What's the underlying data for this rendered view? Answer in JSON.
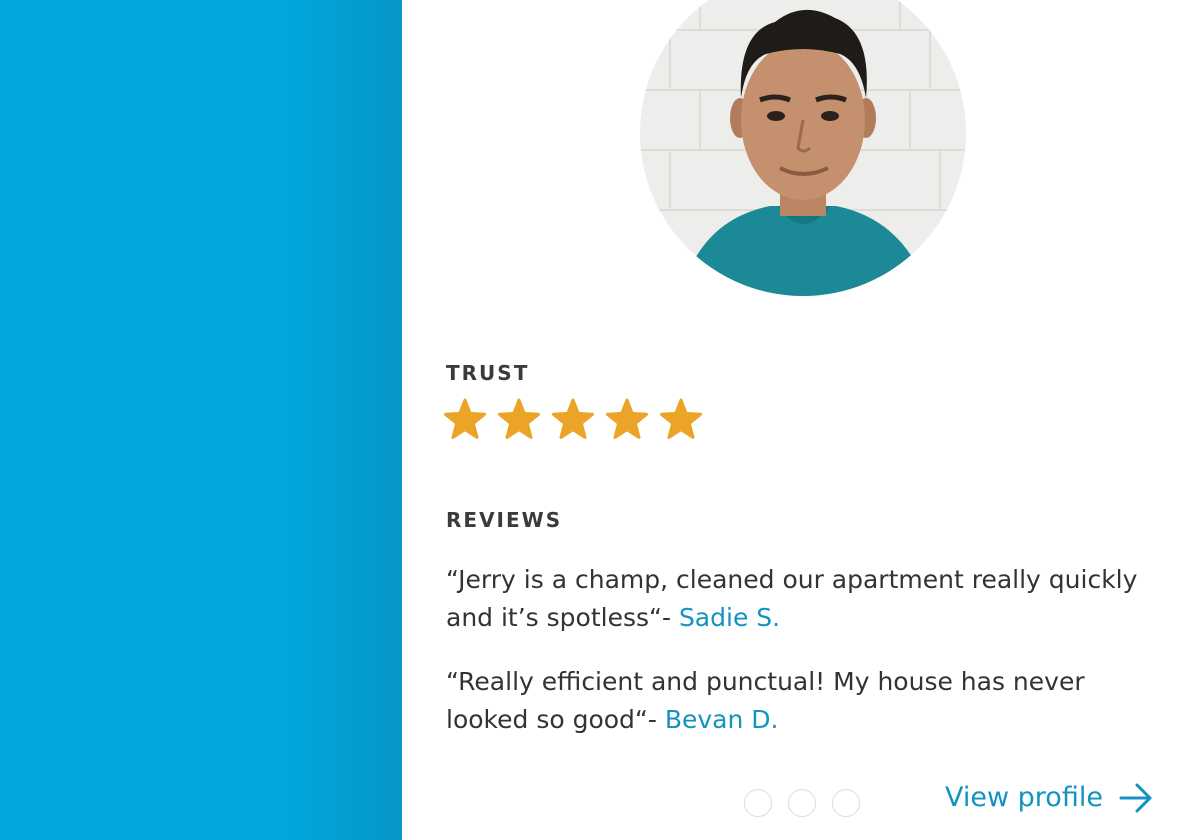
{
  "colors": {
    "accent_blue": "#00a8df",
    "link_blue": "#1493c1",
    "star_gold": "#eba428",
    "text_dark": "#333333"
  },
  "profile": {
    "avatar_icon": "person-photo"
  },
  "trust": {
    "label": "TRUST",
    "rating": 5,
    "max_rating": 5,
    "star_icon": "star-icon"
  },
  "reviews": {
    "label": "REVIEWS",
    "items": [
      {
        "quote": "“Jerry is a champ, cleaned our apartment really quickly and it’s spotless“- ",
        "author": "Sadie S."
      },
      {
        "quote": "“Really efficient and punctual! My house has never looked so good“- ",
        "author": "Bevan D."
      }
    ]
  },
  "pagination": {
    "count": 3
  },
  "cta": {
    "label": "View profile",
    "icon": "arrow-right-icon"
  }
}
